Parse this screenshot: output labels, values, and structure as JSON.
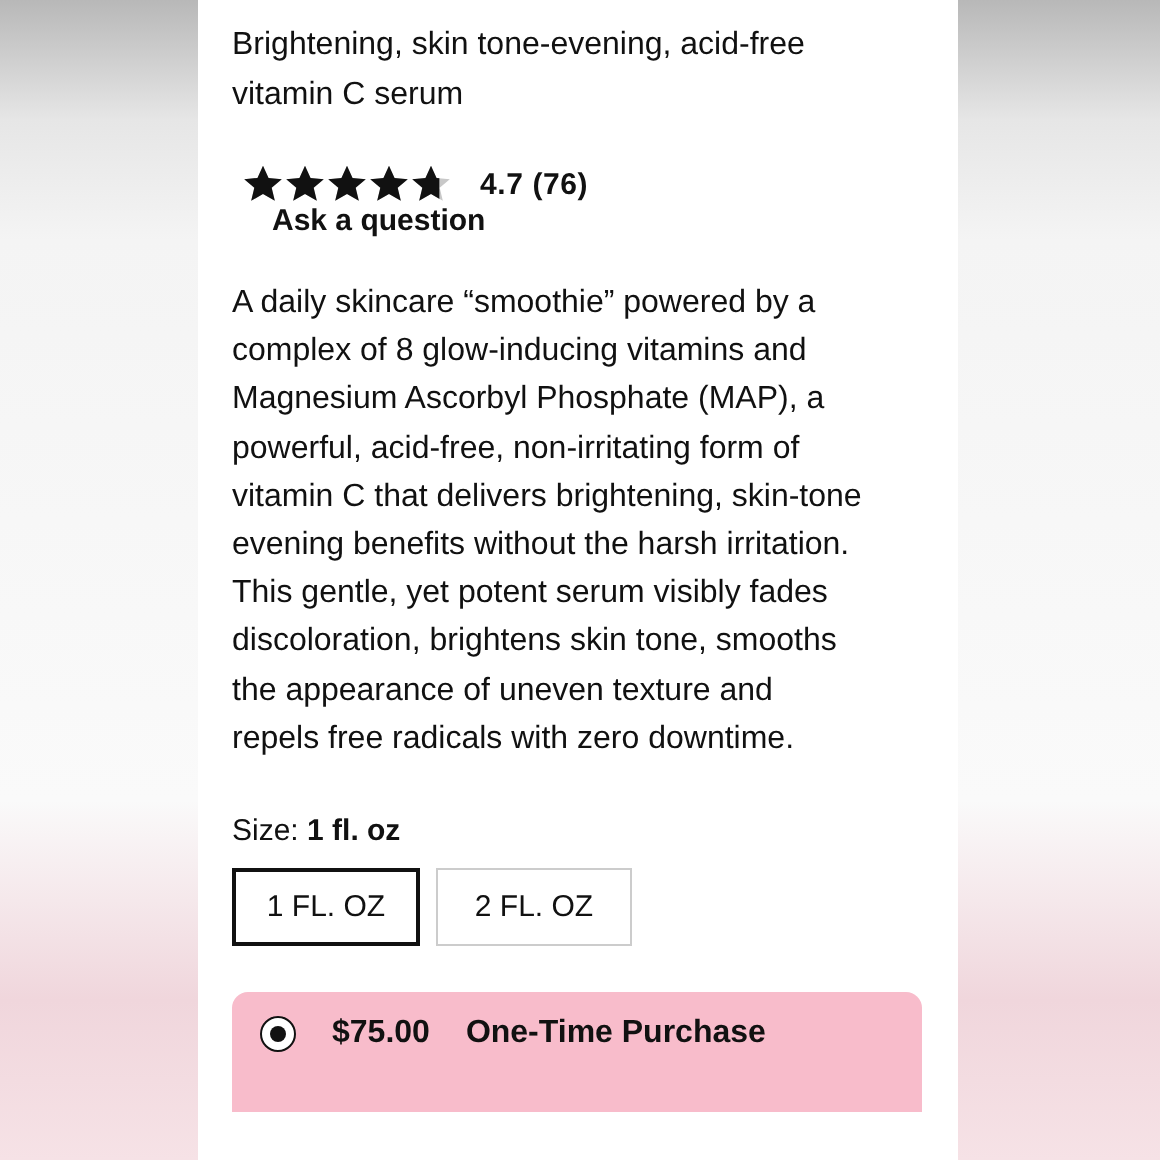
{
  "product": {
    "title": "Brightening, skin tone-evening, acid-free vitamin C serum"
  },
  "rating": {
    "stars": 4.7,
    "score": "4.7",
    "count": "(76)",
    "ask_link": "Ask a question"
  },
  "description": "A daily skincare “smoothie” powered by a complex of 8 glow-inducing vitamins and Magnesium Ascorbyl Phosphate (MAP), a powerful, acid-free, non-irritating form of vitamin C that delivers brightening, skin-tone evening benefits without the harsh irritation. This gentle, yet potent serum visibly fades discoloration, brightens skin tone, smooths the appearance of uneven texture and repels free radicals with zero downtime.",
  "size": {
    "label": "Size:",
    "value": "1 fl. oz",
    "options": [
      {
        "label": "1 FL. OZ",
        "selected": true
      },
      {
        "label": "2 FL. OZ",
        "selected": false
      }
    ]
  },
  "purchase_options": [
    {
      "price": "$75.00",
      "label": "One-Time Purchase",
      "selected": true
    }
  ]
}
